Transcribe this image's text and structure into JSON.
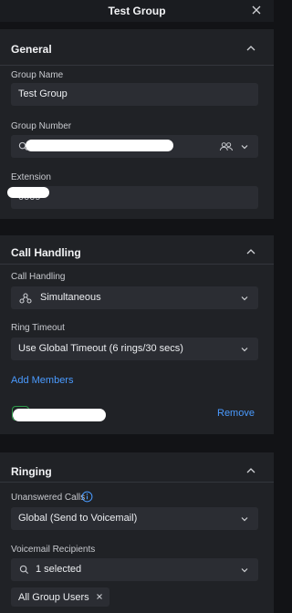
{
  "header": {
    "title": "Test Group"
  },
  "general": {
    "title": "General",
    "group_name_label": "Group Name",
    "group_name_value": "Test Group",
    "group_number_label": "Group Number",
    "extension_label": "Extension",
    "extension_visible": "0009"
  },
  "call_handling": {
    "title": "Call Handling",
    "handling_label": "Call Handling",
    "handling_value": "Simultaneous",
    "ring_timeout_label": "Ring Timeout",
    "ring_timeout_value": "Use Global Timeout (6 rings/30 secs)",
    "add_members": "Add Members",
    "remove": "Remove"
  },
  "ringing": {
    "title": "Ringing",
    "unanswered_label": "Unanswered Calls",
    "unanswered_value": "Global (Send to Voicemail)",
    "vm_recipients_label": "Voicemail Recipients",
    "vm_recipients_value": "1 selected",
    "chip_label": "All Group Users"
  },
  "colors": {
    "accent": "#4a9bff",
    "background": "#121316",
    "card": "#202226",
    "field": "#2b2d33",
    "member_badge": "#2e9b4a"
  }
}
